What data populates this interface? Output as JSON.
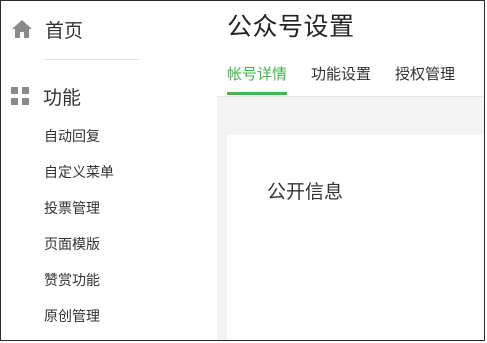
{
  "sidebar": {
    "home_label": "首页",
    "group_label": "功能",
    "items": [
      {
        "label": "自动回复"
      },
      {
        "label": "自定义菜单"
      },
      {
        "label": "投票管理"
      },
      {
        "label": "页面模版"
      },
      {
        "label": "赞赏功能"
      },
      {
        "label": "原创管理"
      }
    ]
  },
  "header": {
    "title": "公众号设置",
    "tabs": [
      {
        "label": "帐号详情",
        "active": true
      },
      {
        "label": "功能设置",
        "active": false
      },
      {
        "label": "授权管理",
        "active": false
      }
    ]
  },
  "card": {
    "section_title": "公开信息"
  },
  "colors": {
    "accent": "#44b549",
    "text": "#333333",
    "icon": "#8a8a8a",
    "content_background": "#f3f3f3"
  },
  "icons": {
    "home": "home-icon",
    "group": "grid-icon"
  }
}
